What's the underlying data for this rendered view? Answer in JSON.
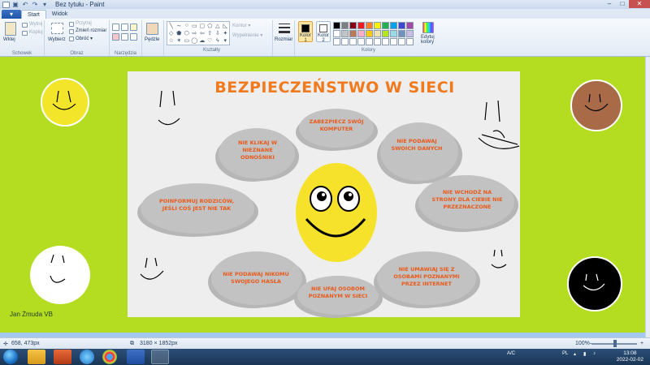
{
  "window": {
    "title": "Bez tytułu - Paint",
    "controls": [
      "–",
      "□",
      "✕"
    ]
  },
  "ribbon": {
    "tabs": [
      "Start",
      "Widok"
    ],
    "file_button": "▾",
    "clipboard": {
      "paste": "Wklej",
      "cut": "Wytnij",
      "copy": "Kopiuj",
      "group": "Schowek"
    },
    "image": {
      "select": "Wybierz",
      "crop": "Przytnij",
      "resize": "Zmień rozmiar",
      "rotate": "Obróć ▾",
      "group": "Obraz"
    },
    "tools": {
      "group": "Narzędzia"
    },
    "brushes": {
      "label": "Pędzle"
    },
    "shapes": {
      "outline": "Kontur ▾",
      "fill": "Wypełnienie ▾",
      "group": "Kształty"
    },
    "size": {
      "label": "Rozmiar"
    },
    "colors": {
      "color1": "Kolor 1",
      "color2": "Kolor 2",
      "edit": "Edytuj kolory",
      "group": "Kolory",
      "color1_value": "#000000",
      "color2_value": "#ffffff",
      "palette": [
        "#000000",
        "#7f7f7f",
        "#880015",
        "#ed1c24",
        "#ff7f27",
        "#fff200",
        "#22b14c",
        "#00a2e8",
        "#3f48cc",
        "#a349a4",
        "#ffffff",
        "#c3c3c3",
        "#b97a57",
        "#ffaec9",
        "#ffc90e",
        "#efe4b0",
        "#b5e61d",
        "#99d9ea",
        "#7092be",
        "#c8bfe7",
        "#ffffff",
        "#ffffff",
        "#ffffff",
        "#ffffff",
        "#ffffff",
        "#ffffff",
        "#ffffff",
        "#ffffff",
        "#ffffff",
        "#ffffff"
      ]
    }
  },
  "canvas": {
    "background": "#b4dd21",
    "author": "Jan Żmuda VB",
    "slide": {
      "title": "BEZPIECZEŃSTWO W SIECI",
      "clouds": [
        "ZABEZPIECZ SWÓJ KOMPUTER",
        "NIE KLIKAJ W NIEZNANE ODNOŚNIKI",
        "NIE PODAWAJ SWOICH DANYCH",
        "POINFORMUJ RODZICÓW, JEŚLI COŚ JEST NIE TAK",
        "NIE WCHODŹ NA STRONY DLA CIEBIE NIE PRZEZNACZONE",
        "NIE PODAWAJ NIKOMU SWOJEGO HASŁA",
        "NIE UFAJ OSOBOM POZNANYM W SIECI",
        "NIE UMAWIAJ SIĘ Z OSOBAMI POZNANYMI PRZEZ INTERNET"
      ]
    },
    "smileys": {
      "yellow": "#f3e52a",
      "brown": "#a86a47",
      "white": "#ffffff",
      "black": "#000000"
    }
  },
  "status": {
    "cursor_pos": "658, 473px",
    "image_size": "3180 × 1852px",
    "zoom": "100%",
    "zoom_minus": "–",
    "zoom_plus": "+"
  },
  "taskbar": {
    "lang": "PL",
    "ac": "A/C",
    "time": "13:08",
    "date": "2022-02-02"
  }
}
